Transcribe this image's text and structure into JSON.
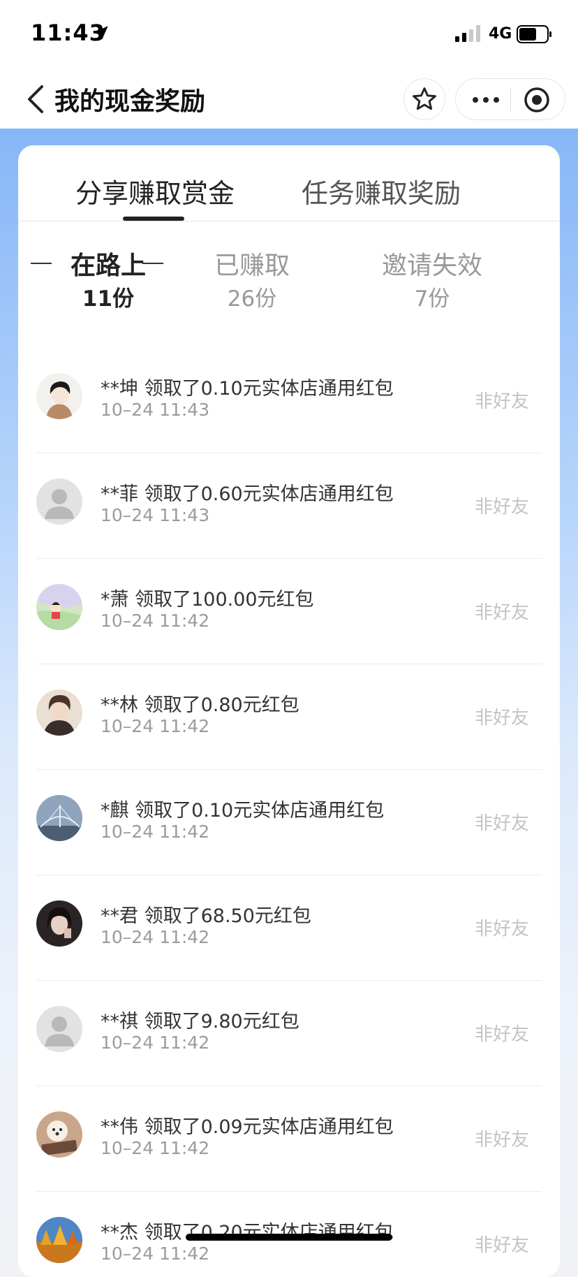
{
  "status_bar": {
    "time": "11:43",
    "network": "4G"
  },
  "nav": {
    "title": "我的现金奖励"
  },
  "tabs": [
    {
      "label": "分享赚取赏金",
      "active": true
    },
    {
      "label": "任务赚取奖励",
      "active": false
    }
  ],
  "sub_tabs": [
    {
      "label": "在路上",
      "count": "11份",
      "active": true
    },
    {
      "label": "已赚取",
      "count": "26份",
      "active": false
    },
    {
      "label": "邀请失效",
      "count": "7份",
      "active": false
    }
  ],
  "records": [
    {
      "title": "**坤 领取了0.10元实体店通用红包",
      "time": "10–24 11:43",
      "tag": "非好友",
      "avatar": "cartoon-boy"
    },
    {
      "title": "**菲 领取了0.60元实体店通用红包",
      "time": "10–24 11:43",
      "tag": "非好友",
      "avatar": "default-person"
    },
    {
      "title": "*萧 领取了100.00元红包",
      "time": "10–24 11:42",
      "tag": "非好友",
      "avatar": "cartoon-child"
    },
    {
      "title": "**林 领取了0.80元红包",
      "time": "10–24 11:42",
      "tag": "非好友",
      "avatar": "anime-man"
    },
    {
      "title": "*麒 领取了0.10元实体店通用红包",
      "time": "10–24 11:42",
      "tag": "非好友",
      "avatar": "bridge-photo"
    },
    {
      "title": "**君 领取了68.50元红包",
      "time": "10–24 11:42",
      "tag": "非好友",
      "avatar": "portrait-photo"
    },
    {
      "title": "**祺 领取了9.80元红包",
      "time": "10–24 11:42",
      "tag": "非好友",
      "avatar": "default-person"
    },
    {
      "title": "**伟 领取了0.09元实体店通用红包",
      "time": "10–24 11:42",
      "tag": "非好友",
      "avatar": "puppy-photo"
    },
    {
      "title": "**杰 领取了0.20元实体店通用红包",
      "time": "10–24 11:42",
      "tag": "非好友",
      "avatar": "autumn-trees-photo"
    }
  ]
}
